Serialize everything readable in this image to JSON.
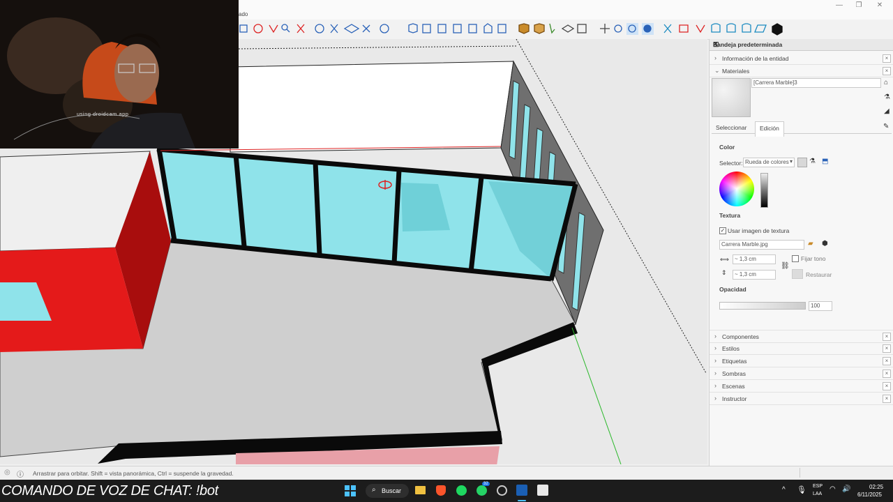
{
  "titlebar": {
    "partial_title": "ado"
  },
  "tray": {
    "title": "Bandeja predeterminada",
    "sections_top": [
      "Información de la entidad",
      "Materiales"
    ],
    "material_name": "[Carrera Marble]3",
    "tabs": [
      "Seleccionar",
      "Edición"
    ],
    "color_heading": "Color",
    "selector_label": "Selector:",
    "selector_value": "Rueda de colores",
    "texture_heading": "Textura",
    "use_texture_label": "Usar imagen de textura",
    "texture_file": "Carrera Marble.jpg",
    "width_value": "~ 1,3 cm",
    "height_value": "~ 1,3 cm",
    "fix_tone_label": "Fijar tono",
    "restore_label": "Restaurar",
    "opacity_heading": "Opacidad",
    "opacity_value": "100",
    "opacity_level": 1.0,
    "sections_bottom": [
      "Componentes",
      "Estilos",
      "Etiquetas",
      "Sombras",
      "Escenas",
      "Instructor"
    ]
  },
  "webcam": {
    "watermark": "using droidcam.app"
  },
  "status": {
    "hint": "Arrastrar para orbitar. Shift = vista panorámica, Ctrl = suspende la gravedad."
  },
  "overlay": {
    "chat_command": "COMANDO DE VOZ DE CHAT: !bot"
  },
  "taskbar": {
    "search_label": "Buscar",
    "lang_top": "ESP",
    "lang_bottom": "LAA",
    "time": "02:25",
    "date": "6/11/2025",
    "whatsapp_badge": "32"
  },
  "colors": {
    "accent_blue": "#1a73e8",
    "glass": "#8fe3ea",
    "red_wall": "#e41a1a",
    "floor_marble": "#d6d6d6"
  }
}
